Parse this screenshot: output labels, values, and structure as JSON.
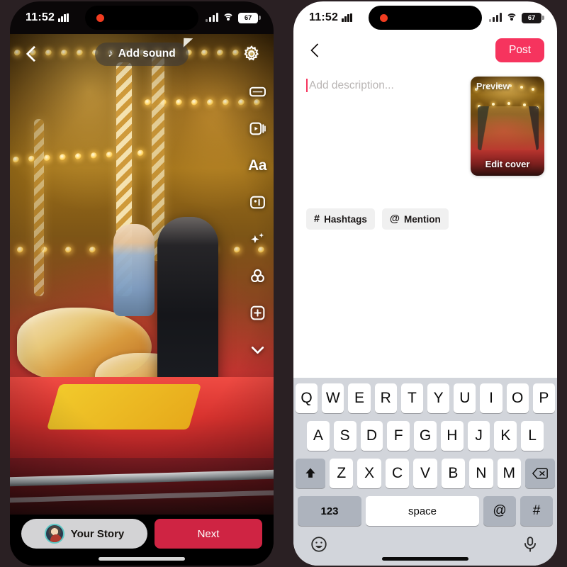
{
  "meta": {
    "background_color": "#2a2023"
  },
  "status_bar": {
    "time": "11:52",
    "signal_icon": "signal-bars-icon",
    "wifi_icon": "wifi-icon",
    "battery_level": "67",
    "recording_icon": "recording-dot-icon",
    "chart_icon": "activity-bars-icon"
  },
  "left_phone": {
    "name": "story-editor-screen",
    "top_bar": {
      "back_icon": "chevron-left-icon",
      "sound_label": "Add sound",
      "sound_note_icon": "music-note-icon",
      "settings_icon": "gear-icon"
    },
    "tools": [
      {
        "name": "aspect-ratio-icon",
        "label": ""
      },
      {
        "name": "effects-icon",
        "label": ""
      },
      {
        "name": "text-icon",
        "label": "Aa"
      },
      {
        "name": "sticker-icon",
        "label": ""
      },
      {
        "name": "enhance-sparkle-icon",
        "label": ""
      },
      {
        "name": "filters-icon",
        "label": ""
      },
      {
        "name": "add-overlay-icon",
        "label": ""
      },
      {
        "name": "chevron-down-icon",
        "label": ""
      }
    ],
    "bottom_bar": {
      "story_label": "Your Story",
      "avatar_icon": "user-avatar",
      "next_label": "Next",
      "next_color": "#cf2443"
    }
  },
  "right_phone": {
    "name": "post-composer-screen",
    "top_bar": {
      "back_icon": "chevron-left-icon",
      "post_label": "Post",
      "post_color": "#f6345e"
    },
    "description": {
      "placeholder": "Add description...",
      "value": "",
      "caret_color": "#f6345e"
    },
    "cover": {
      "preview_label": "Preview",
      "edit_cover_label": "Edit cover"
    },
    "chips": [
      {
        "symbol": "#",
        "label": "Hashtags",
        "name": "hashtags-chip"
      },
      {
        "symbol": "@",
        "label": "Mention",
        "name": "mention-chip"
      }
    ],
    "keyboard": {
      "row1": [
        "Q",
        "W",
        "E",
        "R",
        "T",
        "Y",
        "U",
        "I",
        "O",
        "P"
      ],
      "row2": [
        "A",
        "S",
        "D",
        "F",
        "G",
        "H",
        "J",
        "K",
        "L"
      ],
      "row3": [
        "Z",
        "X",
        "C",
        "V",
        "B",
        "N",
        "M"
      ],
      "shift_icon": "shift-icon",
      "delete_icon": "backspace-icon",
      "numbers_label": "123",
      "space_label": "space",
      "at_label": "@",
      "hash_label": "#",
      "emoji_icon": "emoji-smiley-icon",
      "mic_icon": "microphone-icon"
    }
  }
}
